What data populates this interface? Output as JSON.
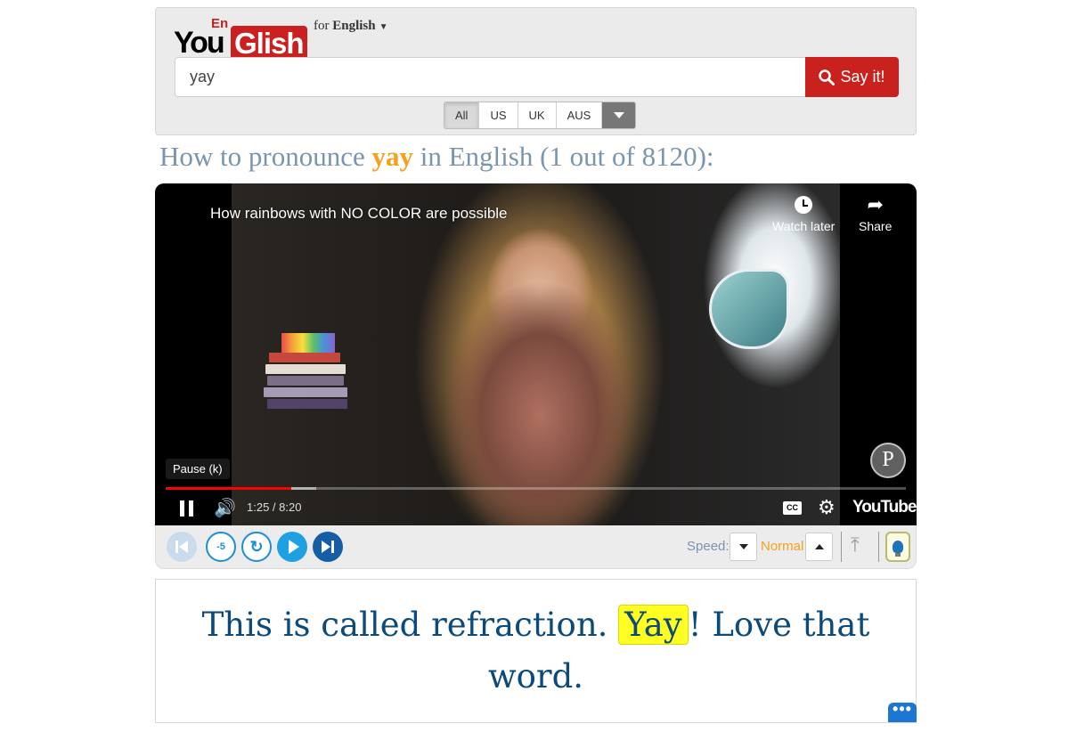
{
  "header": {
    "logo_you": "You",
    "logo_en": "En",
    "logo_glish": "Glish",
    "language_prefix": "for",
    "language": "English"
  },
  "search": {
    "value": "yay",
    "button_label": "Say it!"
  },
  "accents": {
    "options": [
      "All",
      "US",
      "UK",
      "AUS"
    ],
    "selected": "All"
  },
  "result": {
    "prefix": "How to pronounce",
    "word": "yay",
    "suffix": "in English (1 out of 8120):"
  },
  "video": {
    "title": "How rainbows with NO COLOR are possible",
    "watch_later_label": "Watch later",
    "share_label": "Share",
    "tooltip": "Pause (k)",
    "time": "1:25 / 8:20",
    "progress_fraction": 0.17,
    "brand": "YouTube",
    "cc_label": "CC"
  },
  "controls": {
    "back5_label": "-5",
    "speed_label": "Speed:",
    "speed_value": "Normal"
  },
  "caption": {
    "before": "This is called refraction.",
    "highlight": "Yay",
    "after": "! Love that word."
  },
  "more_button": "•••",
  "colors": {
    "brand_red": "#cc1f1f",
    "heading_blue": "#7a95ad",
    "highlight_yellow": "#ffff22",
    "caption_blue": "#0b4a7a",
    "accent_orange": "#f4a21d"
  }
}
